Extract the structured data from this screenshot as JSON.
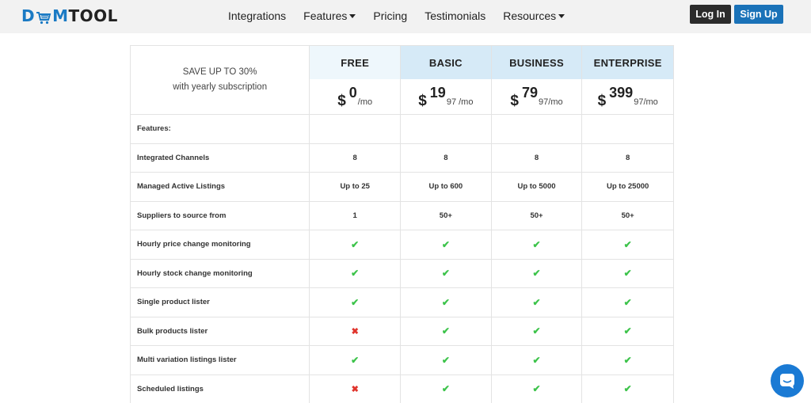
{
  "header": {
    "logo": {
      "part1": "D",
      "part2": "M",
      "part3": "TOOL"
    },
    "nav": [
      {
        "label": "Integrations",
        "dropdown": false
      },
      {
        "label": "Features",
        "dropdown": true
      },
      {
        "label": "Pricing",
        "dropdown": false
      },
      {
        "label": "Testimonials",
        "dropdown": false
      },
      {
        "label": "Resources",
        "dropdown": true
      }
    ],
    "login_label": "Log In",
    "signup_label": "Sign Up"
  },
  "pricing": {
    "promo": {
      "line1": "SAVE UP TO 30%",
      "line2": "with yearly subscription"
    },
    "plans": [
      {
        "name": "FREE",
        "currency": "$",
        "amount": "0",
        "period": "/mo"
      },
      {
        "name": "BASIC",
        "currency": "$",
        "amount": "19",
        "period": "97 /mo"
      },
      {
        "name": "BUSINESS",
        "currency": "$",
        "amount": "79",
        "period": "97/mo"
      },
      {
        "name": "ENTERPRISE",
        "currency": "$",
        "amount": "399",
        "period": "97/mo"
      }
    ],
    "features_heading": "Features:",
    "rows": [
      {
        "label": "Integrated Channels",
        "values": [
          "8",
          "8",
          "8",
          "8"
        ]
      },
      {
        "label": "Managed Active Listings",
        "values": [
          "Up to 25",
          "Up to 600",
          "Up to 5000",
          "Up to 25000"
        ]
      },
      {
        "label": "Suppliers to source from",
        "values": [
          "1",
          "50+",
          "50+",
          "50+"
        ]
      },
      {
        "label": "Hourly price change monitoring",
        "values": [
          "✔",
          "✔",
          "✔",
          "✔"
        ]
      },
      {
        "label": "Hourly stock change monitoring",
        "values": [
          "✔",
          "✔",
          "✔",
          "✔"
        ]
      },
      {
        "label": "Single product lister",
        "values": [
          "✔",
          "✔",
          "✔",
          "✔"
        ]
      },
      {
        "label": "Bulk products lister",
        "values": [
          "✖",
          "✔",
          "✔",
          "✔"
        ]
      },
      {
        "label": "Multi variation listings lister",
        "values": [
          "✔",
          "✔",
          "✔",
          "✔"
        ]
      },
      {
        "label": "Scheduled listings",
        "values": [
          "✖",
          "✔",
          "✔",
          "✔"
        ]
      }
    ]
  },
  "colors": {
    "accent": "#1a72b8",
    "check": "#3cc34a",
    "cross": "#e0342c",
    "header_bg": "#f2f2f2"
  },
  "icons": {
    "chat": "chat-bubble-icon",
    "check": "check-icon",
    "cross": "cross-icon",
    "cart": "cart-icon"
  }
}
